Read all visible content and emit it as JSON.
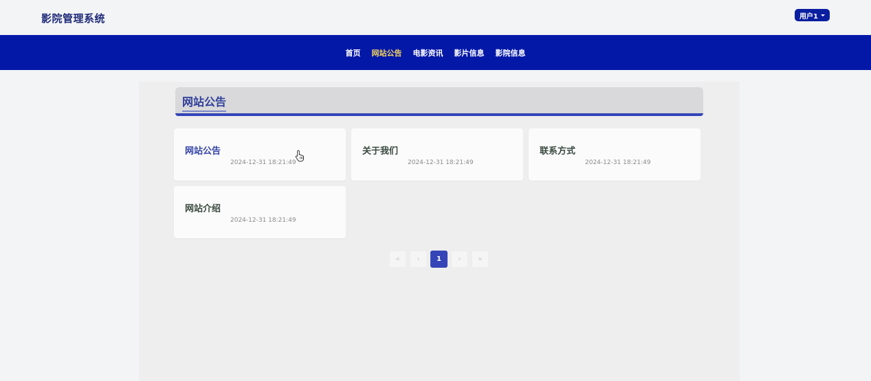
{
  "header": {
    "brand": "影院管理系统",
    "user_label": "用户1"
  },
  "nav": {
    "items": [
      {
        "label": "首页",
        "active": false
      },
      {
        "label": "网站公告",
        "active": true
      },
      {
        "label": "电影资讯",
        "active": false
      },
      {
        "label": "影片信息",
        "active": false
      },
      {
        "label": "影院信息",
        "active": false
      }
    ]
  },
  "section": {
    "title": "网站公告"
  },
  "cards": [
    {
      "title": "网站公告",
      "date": "2024-12-31 18:21:49"
    },
    {
      "title": "关于我们",
      "date": "2024-12-31 18:21:49"
    },
    {
      "title": "联系方式",
      "date": "2024-12-31 18:21:49"
    },
    {
      "title": "网站介绍",
      "date": "2024-12-31 18:21:49"
    }
  ],
  "pagination": {
    "first": "«",
    "prev": "‹",
    "current": "1",
    "next": "›",
    "last": "»"
  },
  "colors": {
    "nav_bg": "#0418a8",
    "nav_active": "#f4d35e",
    "accent": "#3545b8"
  }
}
